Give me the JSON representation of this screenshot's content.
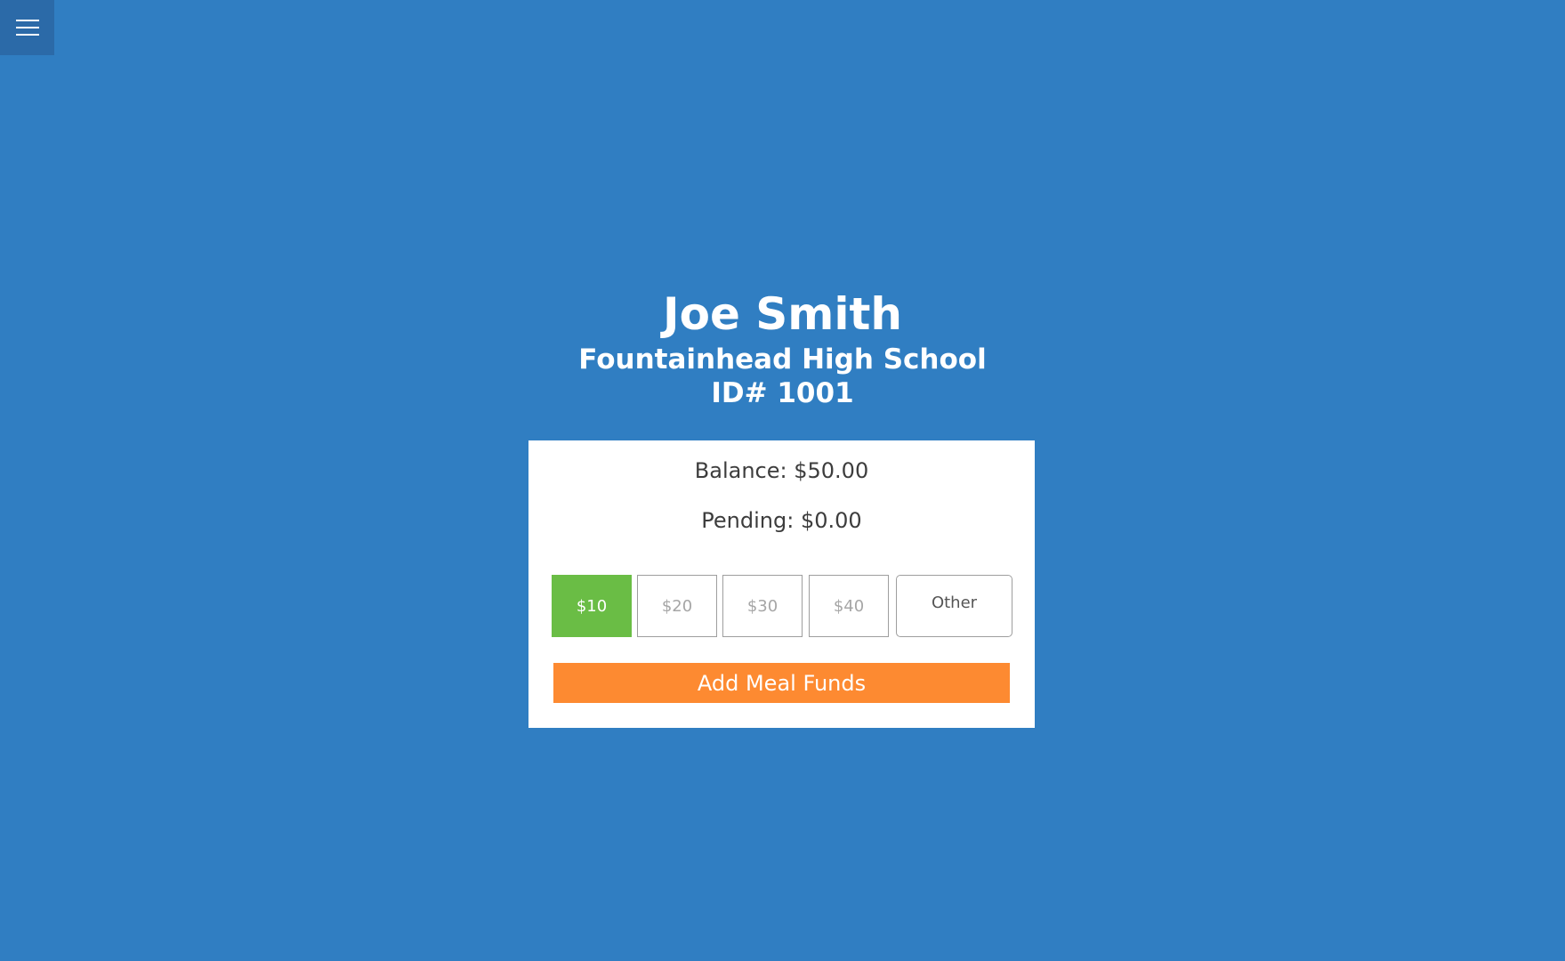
{
  "menu": {
    "icon": "hamburger-menu-icon"
  },
  "student": {
    "name": "Joe Smith",
    "school": "Fountainhead High School",
    "id_line": "ID# 1001"
  },
  "account": {
    "balance_label": "Balance:",
    "balance_value": "$50.00",
    "pending_label": "Pending:",
    "pending_value": "$0.00"
  },
  "amount_options": [
    "$10",
    "$20",
    "$30",
    "$40",
    "Other"
  ],
  "selected_amount": "$10",
  "add_funds_button_label": "Add Meal Funds",
  "colors": {
    "background": "#307ec2",
    "menu_button": "#2b6aa8",
    "selected_option": "#6abd45",
    "add_funds_button": "#fd8a31"
  }
}
